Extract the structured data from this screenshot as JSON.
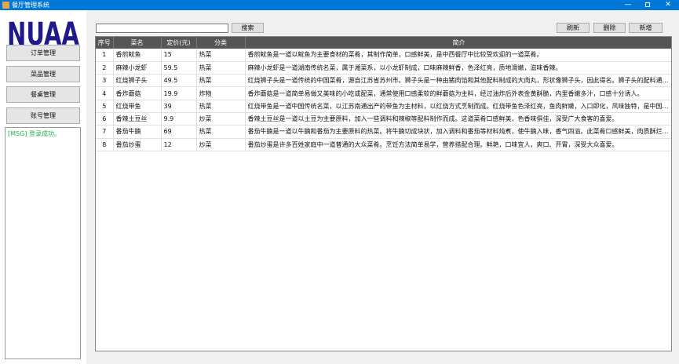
{
  "window": {
    "title": "餐厅管理系统",
    "controls": {
      "minimize": "—",
      "close": "✕"
    }
  },
  "sidebar": {
    "logo_text": "NUAA",
    "items": [
      {
        "label": "订单管理"
      },
      {
        "label": "菜品管理"
      },
      {
        "label": "餐桌管理"
      },
      {
        "label": "账号管理"
      }
    ],
    "message": "[MSG] 登录成功。"
  },
  "toolbar": {
    "search_value": "",
    "search_label": "搜索",
    "refresh_label": "刷新",
    "delete_label": "删除",
    "add_label": "新增"
  },
  "table": {
    "headers": [
      "序号",
      "菜名",
      "定价(元)",
      "分类",
      "简介"
    ],
    "rows": [
      [
        "1",
        "香煎鱿鱼",
        "15",
        "热菜",
        "香煎鱿鱼是一道以鱿鱼为主要食材的菜肴，其制作简单，口感鲜美，是中西餐厅中比较受欢迎的一道菜肴。"
      ],
      [
        "2",
        "麻辣小龙虾",
        "59.5",
        "热菜",
        "麻辣小龙虾是一道湖南传统名菜，属于湘菜系，以小龙虾制成，口味麻辣鲜香，色泽红亮，质地滑嫩，滋味香辣。"
      ],
      [
        "3",
        "红烧狮子头",
        "49.5",
        "热菜",
        "红烧狮子头是一道传统的中国菜肴，源自江苏省苏州市。狮子头是一种由猪肉馅和其他配料制成的大肉丸，形状像狮子头，因此得名。狮子头的配料通常包括猪..."
      ],
      [
        "4",
        "香炸蘑菇",
        "19.9",
        "炸物",
        "香炸蘑菇是一道简单易做又美味的小吃或配菜，通常使用口感柔软的鲜蘑菇为主料，经过油炸后外表金黄酥脆，内里香嫩多汁，口感十分诱人。"
      ],
      [
        "5",
        "红烧带鱼",
        "39",
        "热菜",
        "红烧带鱼是一道中国传统名菜，以江苏南通出产的带鱼为主材料，以红烧方式烹制而成。红烧带鱼色泽红亮，鱼肉鲜嫩，入口即化，风味独特，是中国江苏、浙..."
      ],
      [
        "6",
        "香辣土豆丝",
        "9.9",
        "炒菜",
        "香辣土豆丝是一道以土豆为主要原料，加入一些调料和辣椒等配料制作而成。这道菜肴口感鲜美，色香味俱佳，深受广大食客的喜爱。"
      ],
      [
        "7",
        "番茄牛腩",
        "69",
        "热菜",
        "番茄牛腩是一道以牛腩和番茄为主要原料的热菜。将牛腩切成块状，加入调料和番茄等材料炖煮，使牛腩入味，香气四溢。此菜肴口感鲜美，肉质酥烂，营养丰..."
      ],
      [
        "8",
        "番茄炒蛋",
        "12",
        "炒菜",
        "番茄炒蛋是许多百姓家庭中一道普通的大众菜肴。烹饪方法简单易学，营养搭配合理。鲜艳，口味宜人，爽口、开胃，深受大众喜爱。"
      ]
    ]
  },
  "colors": {
    "titlebar": "#0078d7",
    "logo": "#1f1a8c",
    "message": "#22b14c",
    "table_header": "#555555"
  }
}
